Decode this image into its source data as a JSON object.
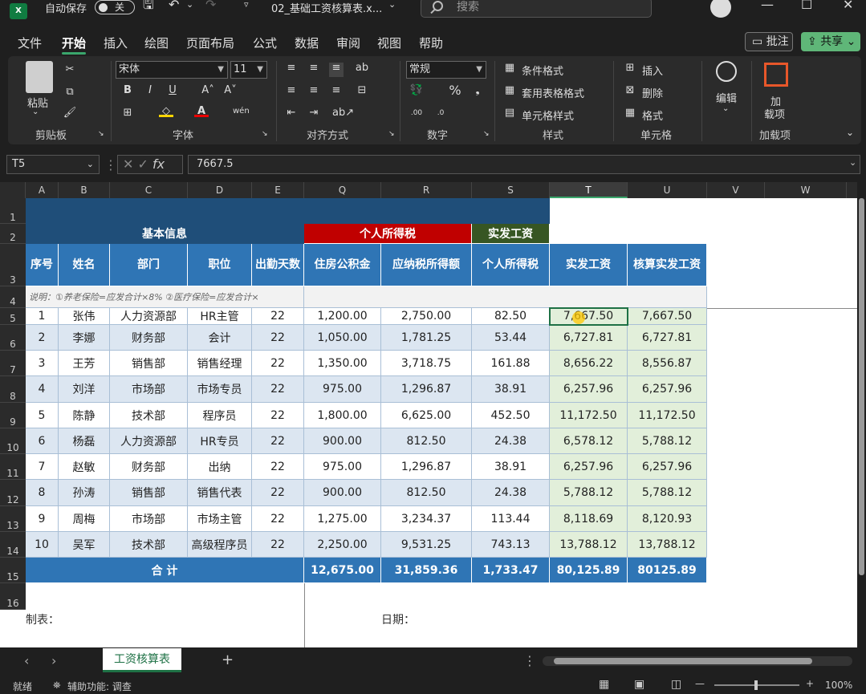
{
  "titlebar": {
    "app_icon": "X",
    "autosave_label": "自动保存",
    "autosave_state": "关",
    "file_name": "02_基础工资核算表.x...",
    "search_placeholder": "搜索"
  },
  "menu": {
    "items": [
      "文件",
      "开始",
      "插入",
      "绘图",
      "页面布局",
      "公式",
      "数据",
      "审阅",
      "视图",
      "帮助"
    ],
    "active": "开始",
    "comment_label": "批注",
    "share_label": "共享"
  },
  "ribbon": {
    "clipboard": {
      "paste": "粘贴",
      "group": "剪贴板"
    },
    "font": {
      "name": "宋体",
      "size": "11",
      "group": "字体",
      "bold": "B",
      "italic": "I",
      "underline": "U",
      "font_color": "A"
    },
    "alignment": {
      "group": "对齐方式"
    },
    "number": {
      "format": "常规",
      "group": "数字",
      "percent": "%"
    },
    "styles": {
      "conditional": "条件格式",
      "table": "套用表格格式",
      "cell": "单元格样式",
      "group": "样式"
    },
    "cells": {
      "insert": "插入",
      "delete": "删除",
      "format": "格式",
      "group": "单元格"
    },
    "editing": {
      "label": "编辑"
    },
    "addins": {
      "label1": "加",
      "label2": "载项",
      "group": "加载项"
    }
  },
  "formula_bar": {
    "name_box": "T5",
    "fx": "fx",
    "value": "7667.5"
  },
  "columns": [
    "A",
    "B",
    "C",
    "D",
    "E",
    "Q",
    "R",
    "S",
    "T",
    "U",
    "V",
    "W",
    "X"
  ],
  "rows": [
    "1",
    "2",
    "3",
    "4",
    "5",
    "6",
    "7",
    "8",
    "9",
    "10",
    "11",
    "12",
    "13",
    "14",
    "15",
    "16"
  ],
  "sheet": {
    "section_basic": "基本信息",
    "section_tax": "个人所得税",
    "section_pay": "实发工资",
    "headers": [
      "序号",
      "姓名",
      "部门",
      "职位",
      "出勤天数",
      "住房公积金",
      "应纳税所得额",
      "个人所得税",
      "实发工资",
      "核算实发工资"
    ],
    "note": "说明：①养老保险=应发合计×8%  ②医疗保险=应发合计×",
    "data": [
      [
        "1",
        "张伟",
        "人力资源部",
        "HR主管",
        "22",
        "1,200.00",
        "2,750.00",
        "82.50",
        "7,667.50",
        "7,667.50"
      ],
      [
        "2",
        "李娜",
        "财务部",
        "会计",
        "22",
        "1,050.00",
        "1,781.25",
        "53.44",
        "6,727.81",
        "6,727.81"
      ],
      [
        "3",
        "王芳",
        "销售部",
        "销售经理",
        "22",
        "1,350.00",
        "3,718.75",
        "161.88",
        "8,656.22",
        "8,556.87"
      ],
      [
        "4",
        "刘洋",
        "市场部",
        "市场专员",
        "22",
        "975.00",
        "1,296.87",
        "38.91",
        "6,257.96",
        "6,257.96"
      ],
      [
        "5",
        "陈静",
        "技术部",
        "程序员",
        "22",
        "1,800.00",
        "6,625.00",
        "452.50",
        "11,172.50",
        "11,172.50"
      ],
      [
        "6",
        "杨磊",
        "人力资源部",
        "HR专员",
        "22",
        "900.00",
        "812.50",
        "24.38",
        "6,578.12",
        "5,788.12"
      ],
      [
        "7",
        "赵敏",
        "财务部",
        "出纳",
        "22",
        "975.00",
        "1,296.87",
        "38.91",
        "6,257.96",
        "6,257.96"
      ],
      [
        "8",
        "孙涛",
        "销售部",
        "销售代表",
        "22",
        "900.00",
        "812.50",
        "24.38",
        "5,788.12",
        "5,788.12"
      ],
      [
        "9",
        "周梅",
        "市场部",
        "市场主管",
        "22",
        "1,275.00",
        "3,234.37",
        "113.44",
        "8,118.69",
        "8,120.93"
      ],
      [
        "10",
        "吴军",
        "技术部",
        "高级程序员",
        "22",
        "2,250.00",
        "9,531.25",
        "743.13",
        "13,788.12",
        "13,788.12"
      ]
    ],
    "total_label": "合  计",
    "totals": [
      "12,675.00",
      "31,859.36",
      "1,733.47",
      "80,125.89",
      "80125.89"
    ],
    "row17_left": "制表：",
    "row17_right": "日期："
  },
  "tabs": {
    "sheet_name": "工资核算表",
    "add": "+"
  },
  "status": {
    "ready": "就绪",
    "accessibility": "辅助功能: 调查",
    "zoom": "100%"
  }
}
